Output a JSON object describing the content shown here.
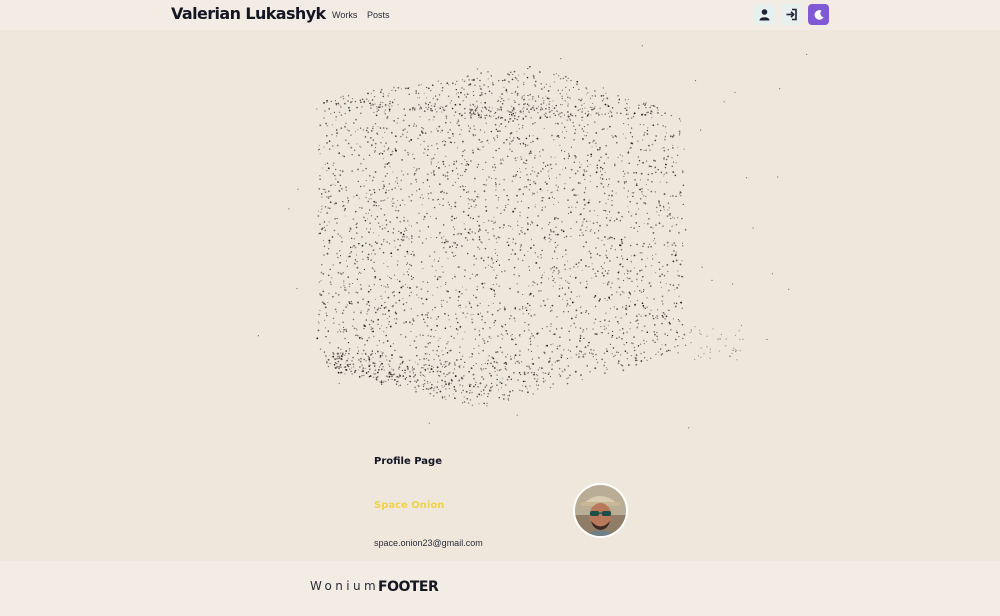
{
  "header": {
    "brand": "Valerian Lukashyk",
    "nav": [
      {
        "label": "Works"
      },
      {
        "label": "Posts"
      }
    ],
    "actions": [
      {
        "icon": "user-icon"
      },
      {
        "icon": "login-icon"
      },
      {
        "icon": "moon-icon",
        "accent": "#805ad5"
      }
    ]
  },
  "hero": {
    "visual": "particle-cube-icon"
  },
  "profile": {
    "title": "Profile Page",
    "name": "Space Onion",
    "email": "space.onion23@gmail.com",
    "avatar": "avatar-photo-icon",
    "name_color": "#f0d24a"
  },
  "footer": {
    "logo": "Wonium",
    "label": "FOOTER"
  },
  "colors": {
    "page_background": "#efe7dc",
    "bar_background": "#f3ece4",
    "accent": "#805ad5",
    "text": "#141623"
  }
}
